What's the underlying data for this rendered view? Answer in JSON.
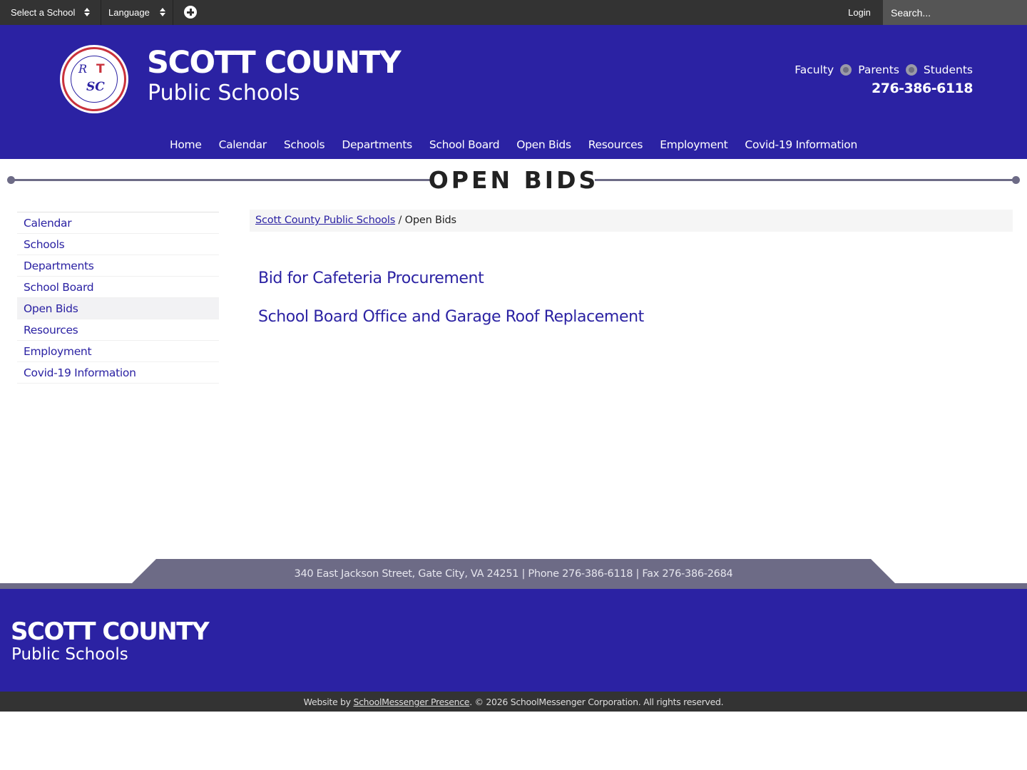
{
  "topbar": {
    "school_select": "Select a School",
    "language_select": "Language",
    "login": "Login",
    "search_placeholder": "Search..."
  },
  "header": {
    "title": "SCOTT COUNTY",
    "subtitle": "Public Schools",
    "quick_links": [
      "Faculty",
      "Parents",
      "Students"
    ],
    "phone": "276-386-6118"
  },
  "nav": {
    "items": [
      "Home",
      "Calendar",
      "Schools",
      "Departments",
      "School Board",
      "Open Bids",
      "Resources",
      "Employment",
      "Covid-19 Information"
    ]
  },
  "page": {
    "title": "OPEN BIDS"
  },
  "sidebar": {
    "items": [
      "Calendar",
      "Schools",
      "Departments",
      "School Board",
      "Open Bids",
      "Resources",
      "Employment",
      "Covid-19 Information"
    ],
    "active": "Open Bids"
  },
  "breadcrumb": {
    "home": "Scott County Public Schools",
    "separator": "/",
    "current": "Open Bids"
  },
  "bids": [
    "Bid for Cafeteria Procurement",
    "School Board Office and Garage Roof Replacement"
  ],
  "footer": {
    "address": "340 East Jackson Street, Gate City, VA 24251 | Phone 276-386-6118 | Fax 276-386-2684",
    "title": "SCOTT COUNTY",
    "subtitle": "Public Schools",
    "copyright_prefix": "Website by",
    "copyright_link": "SchoolMessenger Presence",
    "copyright_suffix": ". © 2026 SchoolMessenger Corporation. All rights reserved."
  },
  "colors": {
    "brand": "#2b22a3",
    "topbar": "#333333",
    "accent_gray": "#6d6b86"
  },
  "icons": {
    "select_arrows": "sort-arrows-icon",
    "translate_plus": "plus-circle-icon",
    "quick_link_separator": "radio-dot-icon"
  }
}
